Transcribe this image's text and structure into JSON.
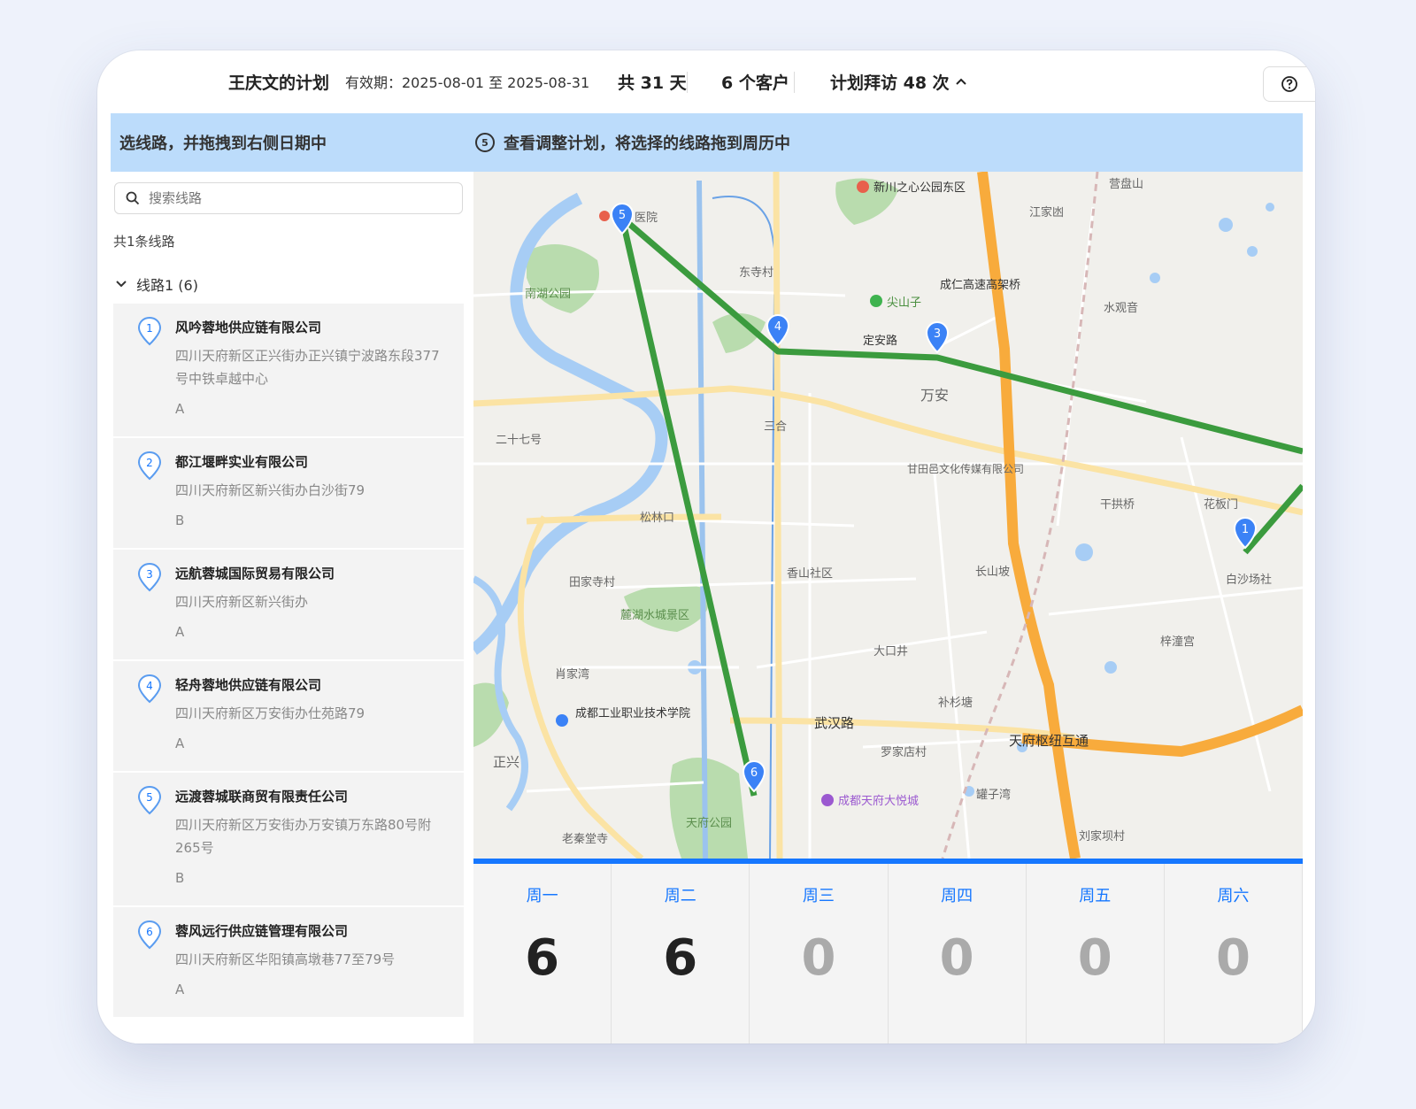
{
  "header": {
    "plan_title": "王庆文的计划",
    "validity": "有效期：2025-08-01 至 2025-08-31",
    "total_days": "共 31 天",
    "customers": "6 个客户",
    "planned_visits": "计划拜访 48 次",
    "help_icon": "question-circle-icon"
  },
  "banner": {
    "step4": "选线路，并拖拽到右侧日期中",
    "step5_num": "5",
    "step5": "查看调整计划，将选择的线路拖到周历中"
  },
  "sidebar": {
    "search_placeholder": "搜索线路",
    "route_count": "共1条线路",
    "route_name": "线路1 (6)",
    "customers": [
      {
        "num": "1",
        "name": "风吟蓉地供应链有限公司",
        "address": "四川天府新区正兴街办正兴镇宁波路东段377号中铁卓越中心",
        "grade": "A"
      },
      {
        "num": "2",
        "name": "都江堰畔实业有限公司",
        "address": "四川天府新区新兴街办白沙街79",
        "grade": "B"
      },
      {
        "num": "3",
        "name": "远航蓉城国际贸易有限公司",
        "address": "四川天府新区新兴街办",
        "grade": "A"
      },
      {
        "num": "4",
        "name": "轻舟蓉地供应链有限公司",
        "address": "四川天府新区万安街办仕苑路79",
        "grade": "A"
      },
      {
        "num": "5",
        "name": "远渡蓉城联商贸有限责任公司",
        "address": "四川天府新区万安街办万安镇万东路80号附265号",
        "grade": "B"
      },
      {
        "num": "6",
        "name": "蓉风远行供应链管理有限公司",
        "address": "四川天府新区华阳镇高墩巷77至79号",
        "grade": "A"
      }
    ]
  },
  "map": {
    "labels": {
      "park_east": "新川之心公园东区",
      "yingpanshan": "营盘山",
      "jiangjiaao": "江家凼",
      "hospital": "医院",
      "nanhu_park": "南湖公园",
      "dongsicun": "东寺村",
      "jianshanzi": "尖山子",
      "chengren": "成仁高速高架桥",
      "shuiguanyin": "水观音",
      "dinganlu": "定安路",
      "wanan": "万安",
      "ershiqi": "二十七号",
      "sanhe": "三合",
      "ganrong": "甘田邑文化传媒有限公司",
      "songlinkou": "松林口",
      "gangqiao": "干拱桥",
      "huaban": "花板门",
      "tianjiasi": "田家寺村",
      "xiangshan": "香山社区",
      "changshanjue": "长山坡",
      "baishashe": "白沙场社",
      "lujiagou": "麓湖水城景区",
      "zizhugong": "梓潼宫",
      "dakouzi": "大口井",
      "xiaojiawan": "肖家湾",
      "chengdugongye": "成都工业职业技术学院",
      "wuhan": "武汉路",
      "hubaotang": "补杉塘",
      "tianfu_interchange": "天府枢纽互通",
      "zhengxing": "正兴",
      "tianfu_joycity": "成都天府大悦城",
      "tianfu_park": "天府公园",
      "laoqin": "老秦堂寺",
      "jiujiaoba": "刘家坝村",
      "yiziwan": "罐子湾",
      "pingtan": "罗家店村"
    }
  },
  "calendar": {
    "days": [
      {
        "name": "周一",
        "count": "6"
      },
      {
        "name": "周二",
        "count": "6"
      },
      {
        "name": "周三",
        "count": "0"
      },
      {
        "name": "周四",
        "count": "0"
      },
      {
        "name": "周五",
        "count": "0"
      },
      {
        "name": "周六",
        "count": "0"
      }
    ],
    "active_color": "#222222",
    "inactive_color": "#aaaaaa",
    "accent": "#1677ff"
  }
}
